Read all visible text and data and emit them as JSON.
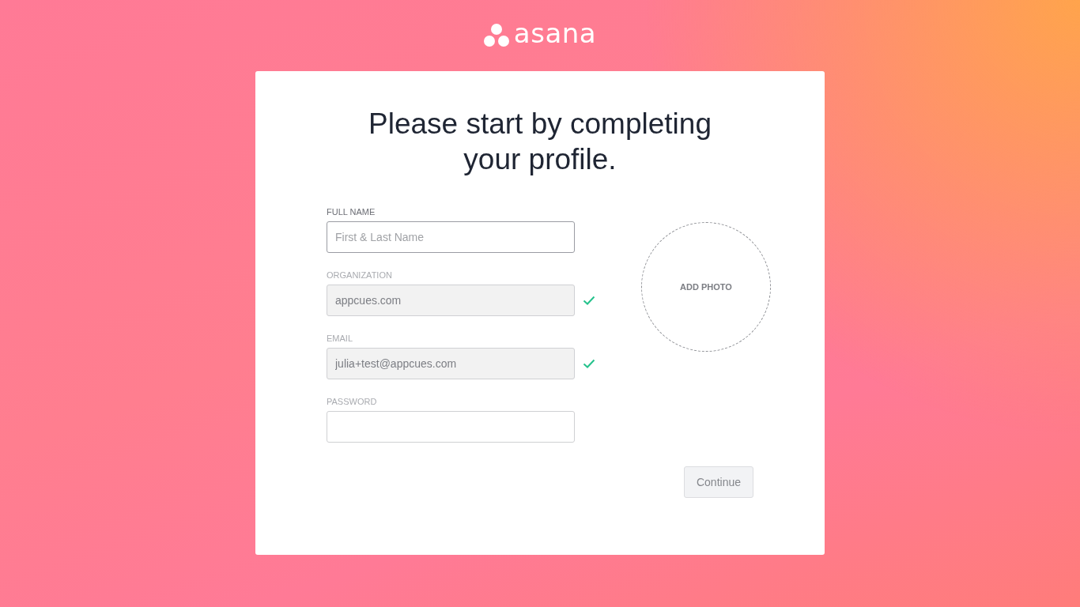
{
  "logo": {
    "text": "asana"
  },
  "heading": "Please start by completing your profile.",
  "fields": [
    {
      "label": "FULL NAME",
      "placeholder": "First & Last Name",
      "focused": true,
      "disabled": false,
      "verified": false
    },
    {
      "label": "ORGANIZATION",
      "value": "appcues.com",
      "focused": false,
      "disabled": true,
      "verified": true
    },
    {
      "label": "EMAIL",
      "value": "julia+test@appcues.com",
      "focused": false,
      "disabled": true,
      "verified": true
    },
    {
      "label": "PASSWORD",
      "focused": false,
      "disabled": false,
      "verified": false
    }
  ],
  "photo": {
    "label": "ADD PHOTO"
  },
  "continue_button": {
    "label": "Continue",
    "disabled": true
  }
}
